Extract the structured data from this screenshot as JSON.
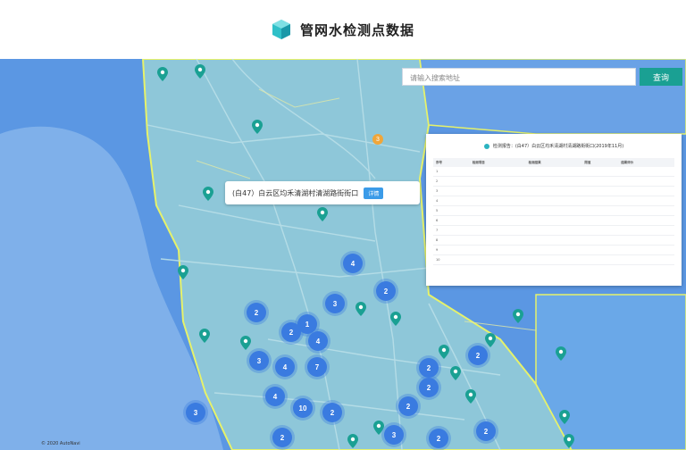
{
  "header": {
    "title": "管网水检测点数据"
  },
  "search": {
    "placeholder": "请输入搜索地址",
    "button_label": "查询"
  },
  "popup": {
    "text": "(白47）白云区均禾清湖村清湖路街街口",
    "button_label": "详情"
  },
  "panel": {
    "title": "检测报告：(白47）白云区均禾清湖村清湖路街街口(2019年11月)",
    "columns": [
      "序号",
      "检测项目",
      "检测结果",
      "限值",
      "结果评价"
    ],
    "rows": [
      [
        "1",
        "",
        "",
        "",
        ""
      ],
      [
        "2",
        "",
        "",
        "",
        ""
      ],
      [
        "3",
        "",
        "",
        "",
        ""
      ],
      [
        "4",
        "",
        "",
        "",
        ""
      ],
      [
        "5",
        "",
        "",
        "",
        ""
      ],
      [
        "6",
        "",
        "",
        "",
        ""
      ],
      [
        "7",
        "",
        "",
        "",
        ""
      ],
      [
        "8",
        "",
        "",
        "",
        ""
      ],
      [
        "9",
        "",
        "",
        "",
        ""
      ],
      [
        "10",
        "",
        "",
        "",
        ""
      ]
    ],
    "notes": [
      "",
      "",
      "",
      ""
    ]
  },
  "map": {
    "clusters": [
      "4",
      "2",
      "3",
      "2",
      "1",
      "2",
      "4",
      "3",
      "4",
      "7",
      "2",
      "4",
      "10",
      "2",
      "2",
      "3",
      "2",
      "2",
      "2",
      "3",
      "2",
      "2"
    ],
    "badge": "3",
    "copyright": "© 2020 AutoNavi"
  },
  "colors": {
    "accent": "#1aa093",
    "water": "#4f8fe0",
    "land": "#8ec7d9",
    "cluster": "#3a7be0",
    "pin": "#1aa093"
  }
}
